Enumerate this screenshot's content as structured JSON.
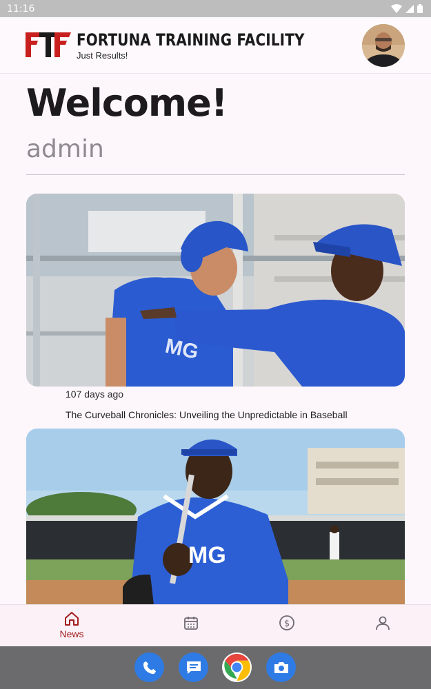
{
  "status_bar": {
    "time": "11:16"
  },
  "header": {
    "brand_title": "FORTUNA TRAINING FACILITY",
    "brand_tagline": "Just Results!",
    "logo_text": "FTF"
  },
  "welcome": {
    "heading": "Welcome!",
    "username": "admin"
  },
  "news": [
    {
      "age": "107 days ago",
      "title": "The Curveball Chronicles: Unveiling the Unpredictable in Baseball"
    },
    {
      "age": "",
      "title": ""
    }
  ],
  "bottom_nav": {
    "items": [
      {
        "label": "News",
        "icon": "home-icon",
        "active": true
      },
      {
        "label": "",
        "icon": "calendar-icon",
        "active": false
      },
      {
        "label": "",
        "icon": "dollar-icon",
        "active": false
      },
      {
        "label": "",
        "icon": "person-icon",
        "active": false
      }
    ]
  },
  "dock": {
    "apps": [
      "phone-icon",
      "messages-icon",
      "chrome-icon",
      "camera-icon"
    ]
  },
  "colors": {
    "accent": "#a11d1d",
    "brand_red": "#c8201e",
    "dock_blue": "#2f7be5"
  }
}
